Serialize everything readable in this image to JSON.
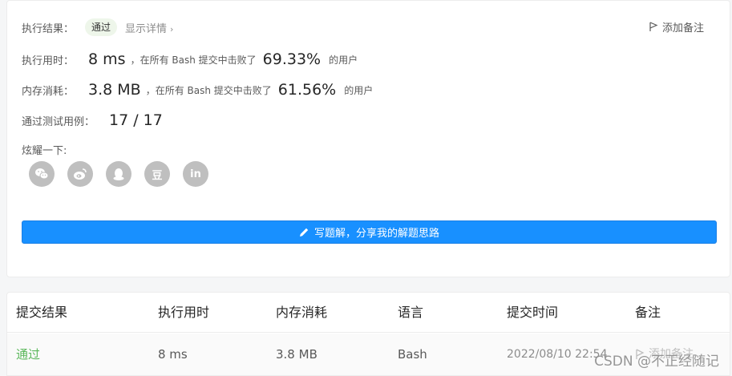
{
  "result": {
    "status_label": "执行结果：",
    "status_value": "通过",
    "details_link": "显示详情",
    "add_note": "添加备注",
    "runtime": {
      "label": "执行用时：",
      "value": "8 ms",
      "middle": "，在所有 Bash 提交中击败了",
      "percent": "69.33%",
      "suffix": "的用户"
    },
    "memory": {
      "label": "内存消耗：",
      "value": "3.8 MB",
      "middle": "，在所有 Bash 提交中击败了",
      "percent": "61.56%",
      "suffix": "的用户"
    },
    "testcases": {
      "label": "通过测试用例：",
      "value": "17 / 17"
    },
    "share": {
      "label": "炫耀一下:",
      "icons": [
        "wechat-icon",
        "weibo-icon",
        "qq-icon",
        "douban-icon",
        "linkedin-icon"
      ],
      "douban_glyph": "豆",
      "linkedin_glyph": "in"
    },
    "write_button": "写题解，分享我的解题思路"
  },
  "table": {
    "headers": [
      "提交结果",
      "执行用时",
      "内存消耗",
      "语言",
      "提交时间",
      "备注"
    ],
    "rows": [
      {
        "result": "通过",
        "runtime": "8 ms",
        "memory": "3.8 MB",
        "language": "Bash",
        "time": "2022/08/10 22:54",
        "note": "添加备注"
      }
    ]
  },
  "watermark": "CSDN @不正经随记",
  "colors": {
    "accent": "#1890ff",
    "success": "#5cb85c",
    "icon_gray": "#bfbfbf"
  }
}
